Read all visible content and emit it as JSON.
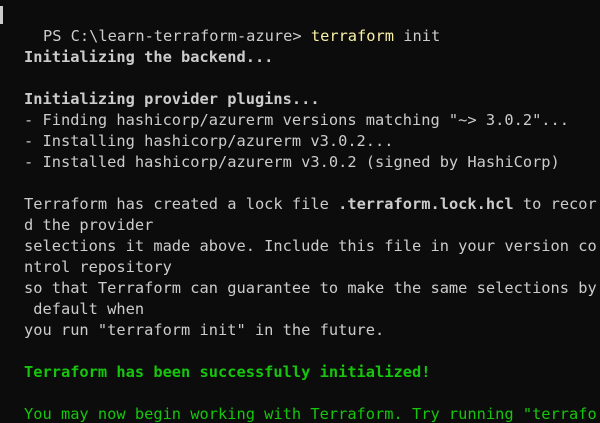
{
  "terminal": {
    "prompt": "PS C:\\learn-terraform-azure> ",
    "command": "terraform",
    "command_args": " init",
    "lines": [
      "Initializing the backend...",
      "Initializing provider plugins...",
      "- Finding hashicorp/azurerm versions matching \"~> 3.0.2\"...",
      "- Installing hashicorp/azurerm v3.0.2...",
      "- Installed hashicorp/azurerm v3.0.2 (signed by HashiCorp)",
      "Terraform has created a lock file ",
      ".terraform.lock.hcl",
      " to recor",
      "d the provider",
      "selections it made above. Include this file in your version co",
      "ntrol repository",
      "so that Terraform can guarantee to make the same selections by",
      " default when",
      "you run \"terraform init\" in the future.",
      "Terraform has been successfully initialized!",
      "You may now begin working with Terraform. Try running \"terrafo"
    ],
    "colors": {
      "background": "#0c0c0c",
      "text": "#cccccc",
      "command": "#f9f1a5",
      "success": "#16c60c"
    }
  }
}
